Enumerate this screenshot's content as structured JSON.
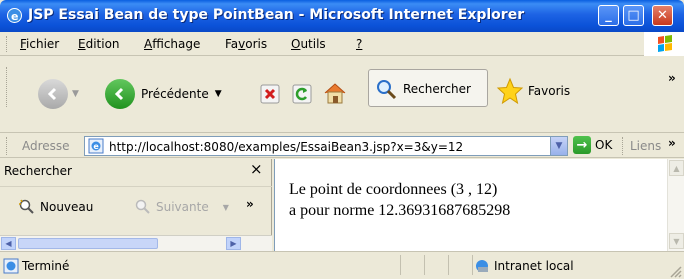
{
  "window": {
    "title": "JSP Essai Bean de type PointBean - Microsoft Internet Explorer",
    "minimize": "_",
    "maximize": "□",
    "close": "✕"
  },
  "menu": {
    "items": [
      {
        "label": "Fichier",
        "key": "F"
      },
      {
        "label": "Edition",
        "key": "E"
      },
      {
        "label": "Affichage",
        "key": "A"
      },
      {
        "label": "Favoris",
        "key": "v"
      },
      {
        "label": "Outils",
        "key": "O"
      },
      {
        "label": "?",
        "key": "?"
      }
    ]
  },
  "toolbar": {
    "back_label": "Précédente",
    "search_label": "Rechercher",
    "favorites_label": "Favoris",
    "overflow": "»"
  },
  "address": {
    "label": "Adresse",
    "url": "http://localhost:8080/examples/EssaiBean3.jsp?x=3&y=12",
    "go_label": "OK",
    "links_label": "Liens",
    "links_overflow": "»"
  },
  "search_panel": {
    "title": "Rechercher",
    "close": "×",
    "new_label": "Nouveau",
    "next_label": "Suivante",
    "overflow": "»"
  },
  "content": {
    "line1": "Le point de coordonnees (3 , 12)",
    "line2": "a pour norme 12.36931687685298"
  },
  "status": {
    "text": "Terminé",
    "zone": "Intranet local"
  },
  "colors": {
    "titlebar": "#0b52d8",
    "chrome": "#ece9d8",
    "content_bg": "#ffffff"
  }
}
